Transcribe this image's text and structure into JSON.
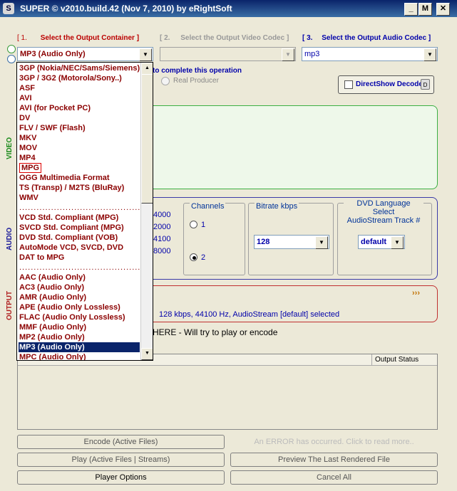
{
  "window": {
    "title": "SUPER © v2010.build.42 (Nov 7, 2010) by eRightSoft",
    "minimize_glyph": "_",
    "maximize_glyph": "M",
    "close_glyph": "✕"
  },
  "headers": {
    "container_num": "[ 1.",
    "container_label": "Select the Output Container ]",
    "video_codec_num": "[ 2.",
    "video_codec_label": "Select the Output Video Codec ]",
    "audio_codec_num": "[ 3.",
    "audio_codec_label": "Select the Output Audio Codec ]"
  },
  "combos": {
    "container_value": "MP3    (Audio Only)",
    "video_codec_value": "",
    "audio_codec_value": "mp3"
  },
  "encoder_row": {
    "prompt": "to complete this operation",
    "real_producer": "Real Producer",
    "directshow_label": "DirectShow Decode"
  },
  "side_labels": {
    "video": "VIDEO",
    "audio": "AUDIO",
    "output": "OUTPUT"
  },
  "audio": {
    "sampling_values": [
      "4000",
      "2000",
      "4100",
      "8000"
    ],
    "channels_legend": "Channels",
    "channel_1": "1",
    "channel_2": "2",
    "bitrate_legend": "Bitrate  kbps",
    "bitrate_value": "128",
    "dvd_legend_1": "DVD Language Select",
    "dvd_legend_2": "AudioStream  Track #",
    "dvd_value": "default"
  },
  "output": {
    "more": "›››",
    "summary": "128 kbps,  44100 Hz,  AudioStream [default] selected"
  },
  "drop_hint": "HERE - Will try to play or encode",
  "table": {
    "columns": [
      "Output Status"
    ]
  },
  "buttons": {
    "encode": "Encode (Active Files)",
    "error": "An ERROR has occurred. Click to read more..",
    "play": "Play (Active Files | Streams)",
    "preview": "Preview The Last Rendered File",
    "player_options": "Player Options",
    "cancel_all": "Cancel All"
  },
  "dropdown": {
    "items": [
      "3GP (Nokia/NEC/Sams/Siemens)",
      "3GP / 3G2 (Motorola/Sony..)",
      "ASF",
      "AVI",
      "AVI  (for Pocket PC)",
      "DV",
      "FLV / SWF (Flash)",
      "MKV",
      "MOV",
      "MP4",
      "MPG",
      "OGG  Multimedia Format",
      "TS (Transp) / M2TS (BluRay)",
      "WMV",
      "....................................................",
      "VCD   Std. Compliant (MPG)",
      "SVCD Std. Compliant (MPG)",
      "DVD   Std. Compliant (VOB)",
      "AutoMode VCD, SVCD, DVD",
      "DAT  to  MPG",
      "....................................................",
      "AAC   (Audio Only)",
      "AC3    (Audio Only)",
      "AMR   (Audio Only)",
      "APE   (Audio Only Lossless)",
      "FLAC  (Audio Only Lossless)",
      "MMF   (Audio Only)",
      "MP2    (Audio Only)",
      "MP3    (Audio Only)",
      "MPC   (Audio Only)"
    ],
    "selected_index": 28,
    "boxed_index": 10
  },
  "colors": {
    "accent_red": "#8b0000",
    "video_panel": "#3cb043",
    "audio_panel": "#3a3aa8",
    "output_panel": "#c03030",
    "selection": "#0a246a"
  }
}
